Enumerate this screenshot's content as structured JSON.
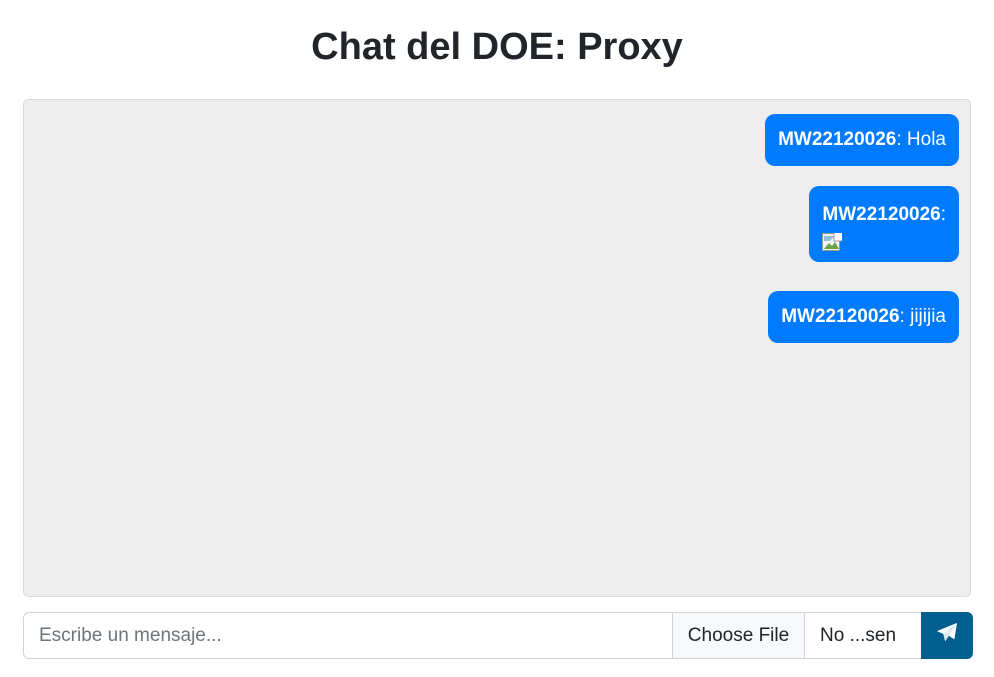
{
  "page": {
    "title": "Chat del DOE: Proxy"
  },
  "messages": [
    {
      "user": "MW22120026",
      "separator": ":",
      "text": " Hola"
    },
    {
      "user": "MW22120026",
      "separator": ":",
      "text": "",
      "attachment": "broken-image-icon"
    },
    {
      "user": "MW22120026",
      "separator": ":",
      "text": " jijijia"
    }
  ],
  "composer": {
    "placeholder": "Escribe un mensaje...",
    "file_button_label": "Choose File",
    "file_status": "No ...sen",
    "send_icon": "paper-plane-icon"
  },
  "colors": {
    "bubble": "#007bff",
    "send_button": "#005f8f",
    "chat_background": "#eeeeee"
  }
}
